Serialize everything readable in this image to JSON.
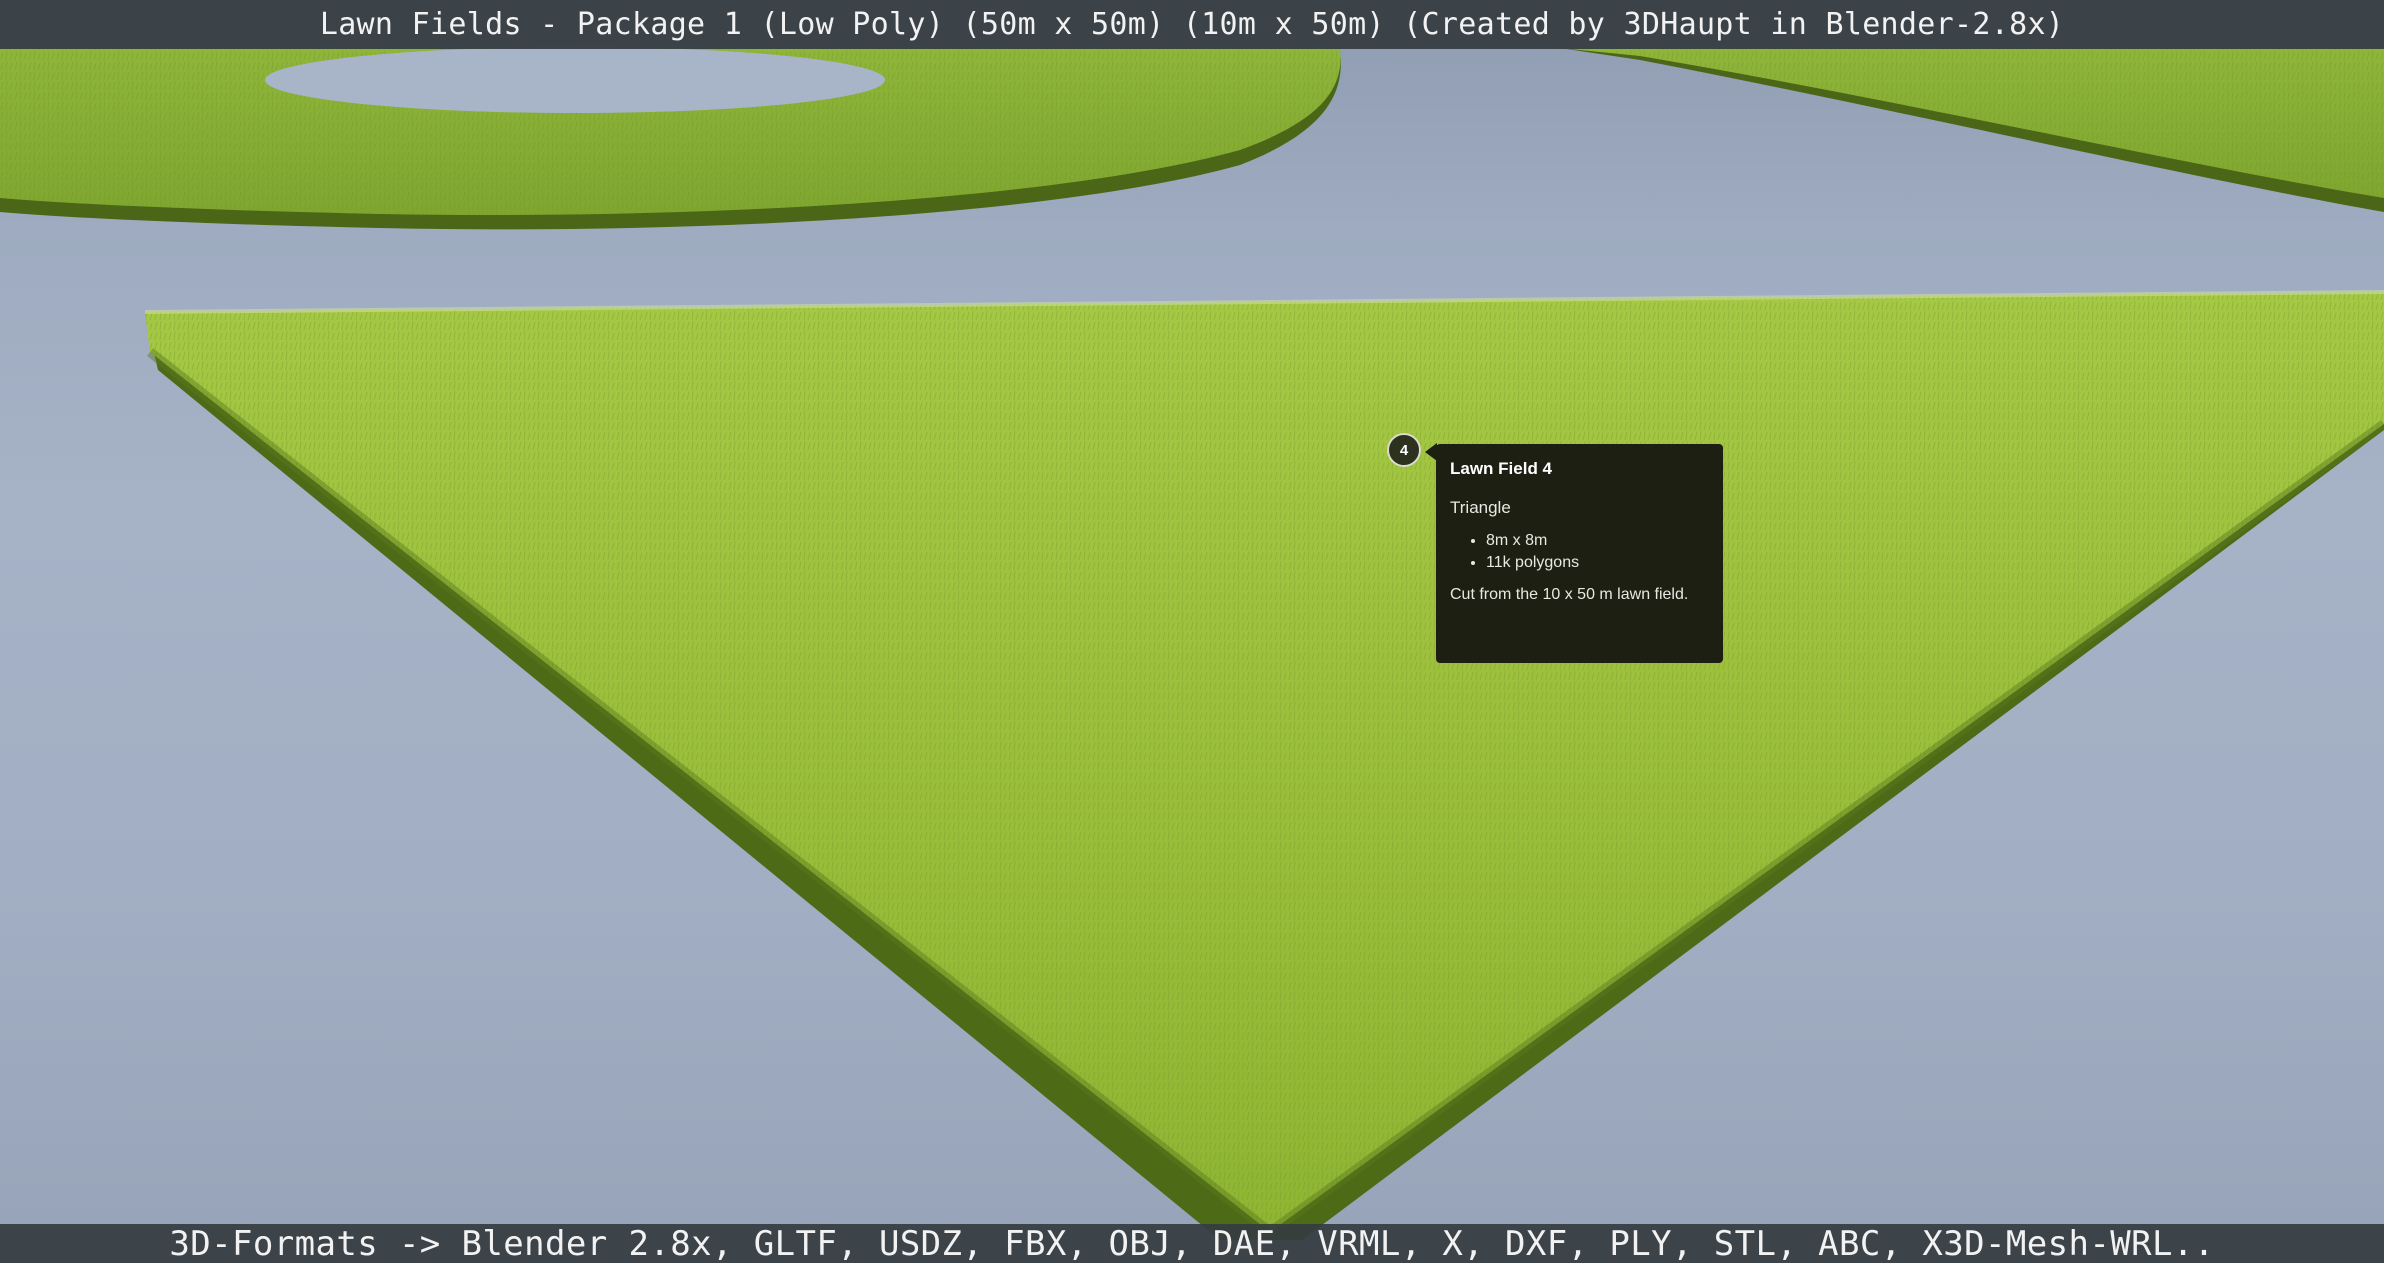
{
  "viewer": {
    "title": "Lawn Fields - Package 1 (Low Poly) (50m x 50m) (10m x 50m) (Created by 3DHaupt in Blender-2.8x)",
    "formats": "3D-Formats -> Blender 2.8x, GLTF, USDZ, FBX, OBJ, DAE, VRML, X, DXF, PLY, STL, ABC, X3D-Mesh-WRL.."
  },
  "annotation": {
    "number": "4",
    "title": "Lawn Field 4",
    "subtitle": "Triangle",
    "bullets": [
      "8m x 8m",
      "11k polygons"
    ],
    "note": "Cut from the 10 x 50 m lawn field."
  },
  "colors": {
    "background": "#a6b2c6",
    "grass_light": "#9ec23c",
    "grass_dark": "#4f6a16",
    "bar": "#343c40",
    "annotation_bg": "#1d1f12"
  }
}
